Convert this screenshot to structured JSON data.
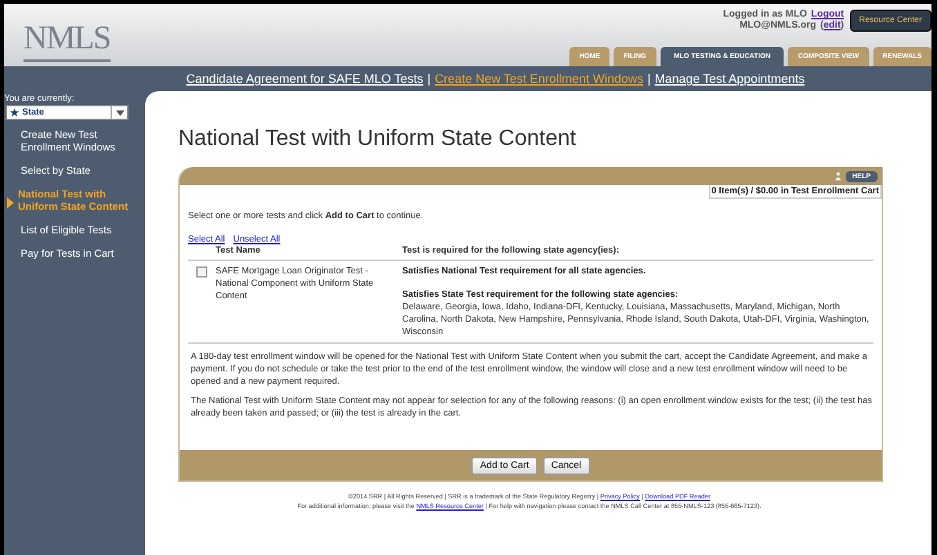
{
  "header": {
    "logo": "NMLS",
    "login_text": "Logged in as MLO",
    "logout": "Logout",
    "email": "MLO@NMLS.org",
    "edit_open": "(",
    "edit": "edit",
    "edit_close": ")",
    "resource_button": "Resource Center"
  },
  "tabs": [
    {
      "label": "HOME",
      "selected": false
    },
    {
      "label": "FILING",
      "selected": false
    },
    {
      "label": "MLO TESTING & EDUCATION",
      "selected": true
    },
    {
      "label": "COMPOSITE VIEW",
      "selected": false
    },
    {
      "label": "RENEWALS",
      "selected": false
    }
  ],
  "subnav": [
    {
      "kind": "link",
      "label": "Candidate Agreement for SAFE MLO Tests",
      "selected": false
    },
    {
      "kind": "separator",
      "label": "|"
    },
    {
      "kind": "link",
      "label": "Create New Test Enrollment Windows",
      "selected": true
    },
    {
      "kind": "separator",
      "label": "|"
    },
    {
      "kind": "link",
      "label": "Manage Test Appointments",
      "selected": false
    }
  ],
  "sidebar": {
    "caption": "You are currently:",
    "dropdown": "State",
    "items": [
      {
        "label": "Create New Test Enrollment Windows",
        "selected": false
      },
      {
        "label": "Select by State",
        "selected": false
      },
      {
        "label": "National Test with Uniform State Content",
        "selected": true
      },
      {
        "label": "List of Eligible Tests",
        "selected": false
      },
      {
        "label": "Pay for Tests in Cart",
        "selected": false
      }
    ]
  },
  "page_title": "National Test with Uniform State Content",
  "panel": {
    "help": "HELP",
    "cart": "0 Item(s) / $0.00 in Test Enrollment Cart",
    "instruction": "Select one or more tests and click **Add to Cart** to continue.",
    "select_all": "Select All",
    "unselect_all": "Unselect All",
    "columns": [
      "Test Name",
      "Test is required for the following state agency(ies):"
    ],
    "rows": [
      {
        "checked": false,
        "name": "SAFE Mortgage Loan Originator Test - National Component with Uniform State Content",
        "national": "Satisfies National Test requirement for all state agencies.",
        "state_heading": "Satisfies State Test requirement for the following state agencies:",
        "states": "Delaware, Georgia, Iowa, Idaho, Indiana-DFI, Kentucky, Louisiana, Massachusetts, Maryland, Michigan, North Carolina, North Dakota, New Hampshire, Pennsylvania, Rhode Island, South Dakota, Utah-DFI, Virginia, Washington, Wisconsin"
      }
    ],
    "notes": [
      "A 180-day test enrollment window will be opened for the National Test with Uniform State Content when you submit the cart, accept the Candidate Agreement, and make a payment. If you do not schedule or take the test prior to the end of the test enrollment window, the window will close and a new test enrollment window will need to be opened and a new payment required.",
      "The National Test with Uniform State Content may not appear for selection for any of the following reasons: (i) an open enrollment window exists for the test; (ii) the test has already been taken and passed; or (iii) the test is already in the cart."
    ],
    "buttons": [
      "Add to Cart",
      "Cancel"
    ]
  },
  "footer": [
    [
      {
        "kind": "text",
        "text": "©2014 SRR | All Rights Reserved | SRR is a trademark of the State Regulatory Registry | "
      },
      {
        "kind": "link",
        "text": "Privacy Policy"
      },
      {
        "kind": "text",
        "text": " | "
      },
      {
        "kind": "link",
        "text": "Download PDF Reader"
      }
    ],
    [
      {
        "kind": "text",
        "text": "For additional information, please visit the "
      },
      {
        "kind": "link",
        "text": "NMLS Resource Center"
      },
      {
        "kind": "text",
        "text": " | For help with navigation please contact the NMLS Call Center at 855-NMLS-123 (855-665-7123)."
      }
    ]
  ]
}
